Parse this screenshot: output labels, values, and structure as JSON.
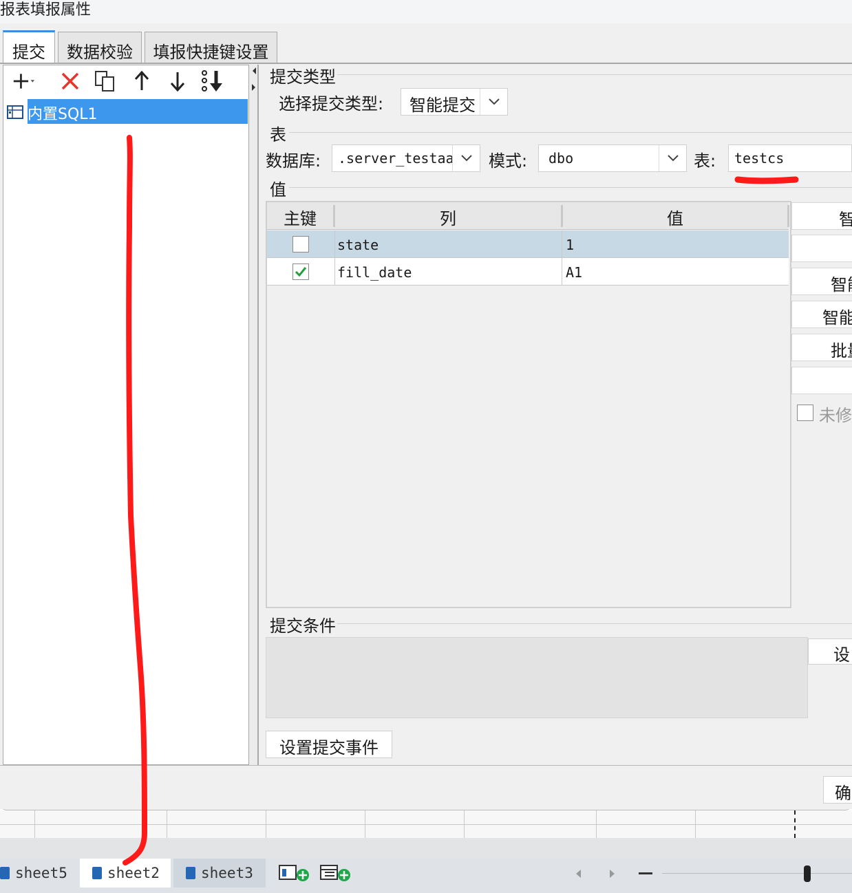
{
  "window": {
    "title": "报表填报属性"
  },
  "tabs": [
    {
      "label": "提交"
    },
    {
      "label": "数据校验"
    },
    {
      "label": "填报快捷键设置"
    }
  ],
  "tree": {
    "items": [
      {
        "label": "内置SQL1",
        "selected": true
      }
    ]
  },
  "submit_type": {
    "section": "提交类型",
    "label": "选择提交类型:",
    "value": "智能提交"
  },
  "table_section": {
    "section": "表",
    "db_label": "数据库:",
    "db_value": ".server_testaa",
    "schema_label": "模式:",
    "schema_value": "dbo",
    "table_label": "表:",
    "table_value": "testcs"
  },
  "values_section": {
    "section": "值",
    "headers": {
      "pk": "主键",
      "column": "列",
      "value": "值"
    },
    "rows": [
      {
        "pk": false,
        "column": "state",
        "value": "1"
      },
      {
        "pk": true,
        "column": "fill_date",
        "value": "A1"
      }
    ]
  },
  "side_buttons": {
    "b1": "智",
    "b3": "智能",
    "b4": "智能",
    "b5": "批量",
    "unmodified": "未修"
  },
  "condition_section": {
    "section": "提交条件",
    "set_button": "设"
  },
  "event_button": "设置提交事件",
  "ok_button": "确",
  "sheets": [
    {
      "name": "sheet5"
    },
    {
      "name": "sheet2",
      "active": true
    },
    {
      "name": "sheet3"
    }
  ],
  "colors": {
    "accent": "#3c97ed",
    "annotation": "#ff1a1a",
    "check": "#22a03c"
  }
}
